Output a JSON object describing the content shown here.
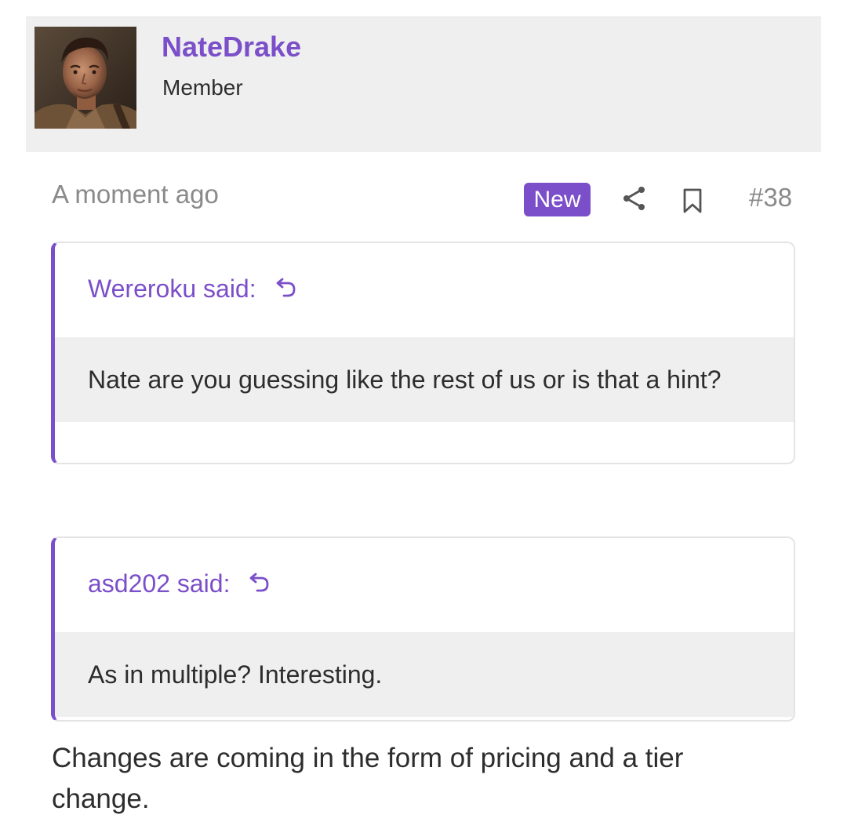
{
  "user": {
    "name": "NateDrake",
    "title": "Member"
  },
  "post": {
    "time": "A moment ago",
    "badge": "New",
    "number": "#38",
    "message": "Changes are coming in the form of pricing and a tier change."
  },
  "quotes": [
    {
      "author": "Wereroku said:",
      "text": "Nate are you guessing like the rest of us or is that a hint?"
    },
    {
      "author": "asd202 said:",
      "text": "As in multiple? Interesting."
    }
  ],
  "icons": {
    "share": "share-icon",
    "bookmark": "bookmark-icon",
    "quote_link": "reply-arrow-icon"
  },
  "colors": {
    "accent": "#7b4fc9",
    "header_bg": "#efefef",
    "quote_body_bg": "#efefef",
    "muted_text": "#8a8a8a",
    "body_text": "#2d2d2d"
  }
}
